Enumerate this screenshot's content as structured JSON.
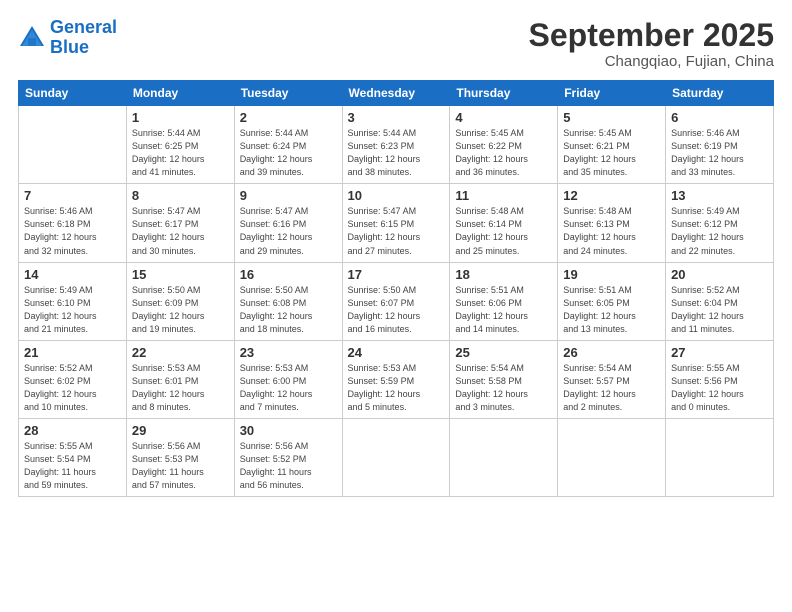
{
  "header": {
    "logo_line1": "General",
    "logo_line2": "Blue",
    "month": "September 2025",
    "location": "Changqiao, Fujian, China"
  },
  "weekdays": [
    "Sunday",
    "Monday",
    "Tuesday",
    "Wednesday",
    "Thursday",
    "Friday",
    "Saturday"
  ],
  "weeks": [
    [
      {
        "day": "",
        "info": ""
      },
      {
        "day": "1",
        "info": "Sunrise: 5:44 AM\nSunset: 6:25 PM\nDaylight: 12 hours\nand 41 minutes."
      },
      {
        "day": "2",
        "info": "Sunrise: 5:44 AM\nSunset: 6:24 PM\nDaylight: 12 hours\nand 39 minutes."
      },
      {
        "day": "3",
        "info": "Sunrise: 5:44 AM\nSunset: 6:23 PM\nDaylight: 12 hours\nand 38 minutes."
      },
      {
        "day": "4",
        "info": "Sunrise: 5:45 AM\nSunset: 6:22 PM\nDaylight: 12 hours\nand 36 minutes."
      },
      {
        "day": "5",
        "info": "Sunrise: 5:45 AM\nSunset: 6:21 PM\nDaylight: 12 hours\nand 35 minutes."
      },
      {
        "day": "6",
        "info": "Sunrise: 5:46 AM\nSunset: 6:19 PM\nDaylight: 12 hours\nand 33 minutes."
      }
    ],
    [
      {
        "day": "7",
        "info": "Sunrise: 5:46 AM\nSunset: 6:18 PM\nDaylight: 12 hours\nand 32 minutes."
      },
      {
        "day": "8",
        "info": "Sunrise: 5:47 AM\nSunset: 6:17 PM\nDaylight: 12 hours\nand 30 minutes."
      },
      {
        "day": "9",
        "info": "Sunrise: 5:47 AM\nSunset: 6:16 PM\nDaylight: 12 hours\nand 29 minutes."
      },
      {
        "day": "10",
        "info": "Sunrise: 5:47 AM\nSunset: 6:15 PM\nDaylight: 12 hours\nand 27 minutes."
      },
      {
        "day": "11",
        "info": "Sunrise: 5:48 AM\nSunset: 6:14 PM\nDaylight: 12 hours\nand 25 minutes."
      },
      {
        "day": "12",
        "info": "Sunrise: 5:48 AM\nSunset: 6:13 PM\nDaylight: 12 hours\nand 24 minutes."
      },
      {
        "day": "13",
        "info": "Sunrise: 5:49 AM\nSunset: 6:12 PM\nDaylight: 12 hours\nand 22 minutes."
      }
    ],
    [
      {
        "day": "14",
        "info": "Sunrise: 5:49 AM\nSunset: 6:10 PM\nDaylight: 12 hours\nand 21 minutes."
      },
      {
        "day": "15",
        "info": "Sunrise: 5:50 AM\nSunset: 6:09 PM\nDaylight: 12 hours\nand 19 minutes."
      },
      {
        "day": "16",
        "info": "Sunrise: 5:50 AM\nSunset: 6:08 PM\nDaylight: 12 hours\nand 18 minutes."
      },
      {
        "day": "17",
        "info": "Sunrise: 5:50 AM\nSunset: 6:07 PM\nDaylight: 12 hours\nand 16 minutes."
      },
      {
        "day": "18",
        "info": "Sunrise: 5:51 AM\nSunset: 6:06 PM\nDaylight: 12 hours\nand 14 minutes."
      },
      {
        "day": "19",
        "info": "Sunrise: 5:51 AM\nSunset: 6:05 PM\nDaylight: 12 hours\nand 13 minutes."
      },
      {
        "day": "20",
        "info": "Sunrise: 5:52 AM\nSunset: 6:04 PM\nDaylight: 12 hours\nand 11 minutes."
      }
    ],
    [
      {
        "day": "21",
        "info": "Sunrise: 5:52 AM\nSunset: 6:02 PM\nDaylight: 12 hours\nand 10 minutes."
      },
      {
        "day": "22",
        "info": "Sunrise: 5:53 AM\nSunset: 6:01 PM\nDaylight: 12 hours\nand 8 minutes."
      },
      {
        "day": "23",
        "info": "Sunrise: 5:53 AM\nSunset: 6:00 PM\nDaylight: 12 hours\nand 7 minutes."
      },
      {
        "day": "24",
        "info": "Sunrise: 5:53 AM\nSunset: 5:59 PM\nDaylight: 12 hours\nand 5 minutes."
      },
      {
        "day": "25",
        "info": "Sunrise: 5:54 AM\nSunset: 5:58 PM\nDaylight: 12 hours\nand 3 minutes."
      },
      {
        "day": "26",
        "info": "Sunrise: 5:54 AM\nSunset: 5:57 PM\nDaylight: 12 hours\nand 2 minutes."
      },
      {
        "day": "27",
        "info": "Sunrise: 5:55 AM\nSunset: 5:56 PM\nDaylight: 12 hours\nand 0 minutes."
      }
    ],
    [
      {
        "day": "28",
        "info": "Sunrise: 5:55 AM\nSunset: 5:54 PM\nDaylight: 11 hours\nand 59 minutes."
      },
      {
        "day": "29",
        "info": "Sunrise: 5:56 AM\nSunset: 5:53 PM\nDaylight: 11 hours\nand 57 minutes."
      },
      {
        "day": "30",
        "info": "Sunrise: 5:56 AM\nSunset: 5:52 PM\nDaylight: 11 hours\nand 56 minutes."
      },
      {
        "day": "",
        "info": ""
      },
      {
        "day": "",
        "info": ""
      },
      {
        "day": "",
        "info": ""
      },
      {
        "day": "",
        "info": ""
      }
    ]
  ]
}
